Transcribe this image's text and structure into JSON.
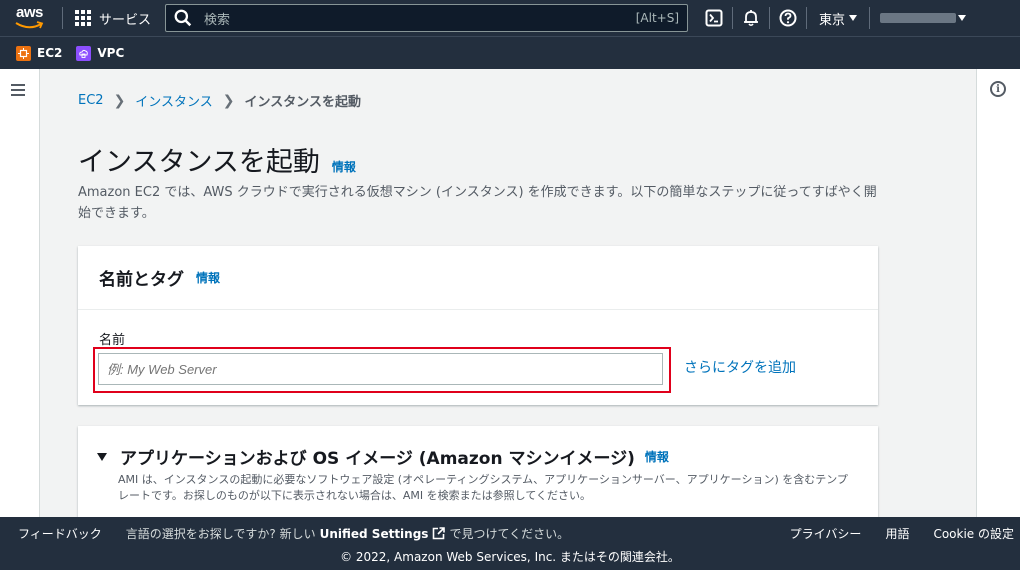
{
  "topnav": {
    "logo_text": "aws",
    "services_label": "サービス",
    "search_placeholder": "検索",
    "search_shortcut": "[Alt+S]",
    "region_label": "東京"
  },
  "favorites": [
    {
      "label": "EC2",
      "color": "#ec7211"
    },
    {
      "label": "VPC",
      "color": "#8c4fff"
    }
  ],
  "breadcrumb": {
    "items": [
      "EC2",
      "インスタンス"
    ],
    "current": "インスタンスを起動"
  },
  "page": {
    "title": "インスタンスを起動",
    "info_label": "情報",
    "description": "Amazon EC2 では、AWS クラウドで実行される仮想マシン (インスタンス) を作成できます。以下の簡単なステップに従ってすばやく開始できます。"
  },
  "name_tags": {
    "heading": "名前とタグ",
    "info_label": "情報",
    "field_label": "名前",
    "input_placeholder": "例: My Web Server",
    "add_tags_label": "さらにタグを追加"
  },
  "ami": {
    "heading": "アプリケーションおよび OS イメージ (Amazon マシンイメージ)",
    "info_label": "情報",
    "description": "AMI は、インスタンスの起動に必要なソフトウェア設定 (オペレーティングシステム、アプリケーションサーバー、アプリケーション) を含むテンプレートです。お探しのものが以下に表示されない場合は、AMI を検索または参照してください。"
  },
  "footer": {
    "feedback": "フィードバック",
    "lang_prefix": "言語の選択をお探しですか? 新しい",
    "lang_link": "Unified Settings",
    "lang_suffix": "で見つけてください。",
    "privacy": "プライバシー",
    "terms": "用語",
    "cookie": "Cookie の設定",
    "copyright": "© 2022, Amazon Web Services, Inc. またはその関連会社。"
  }
}
